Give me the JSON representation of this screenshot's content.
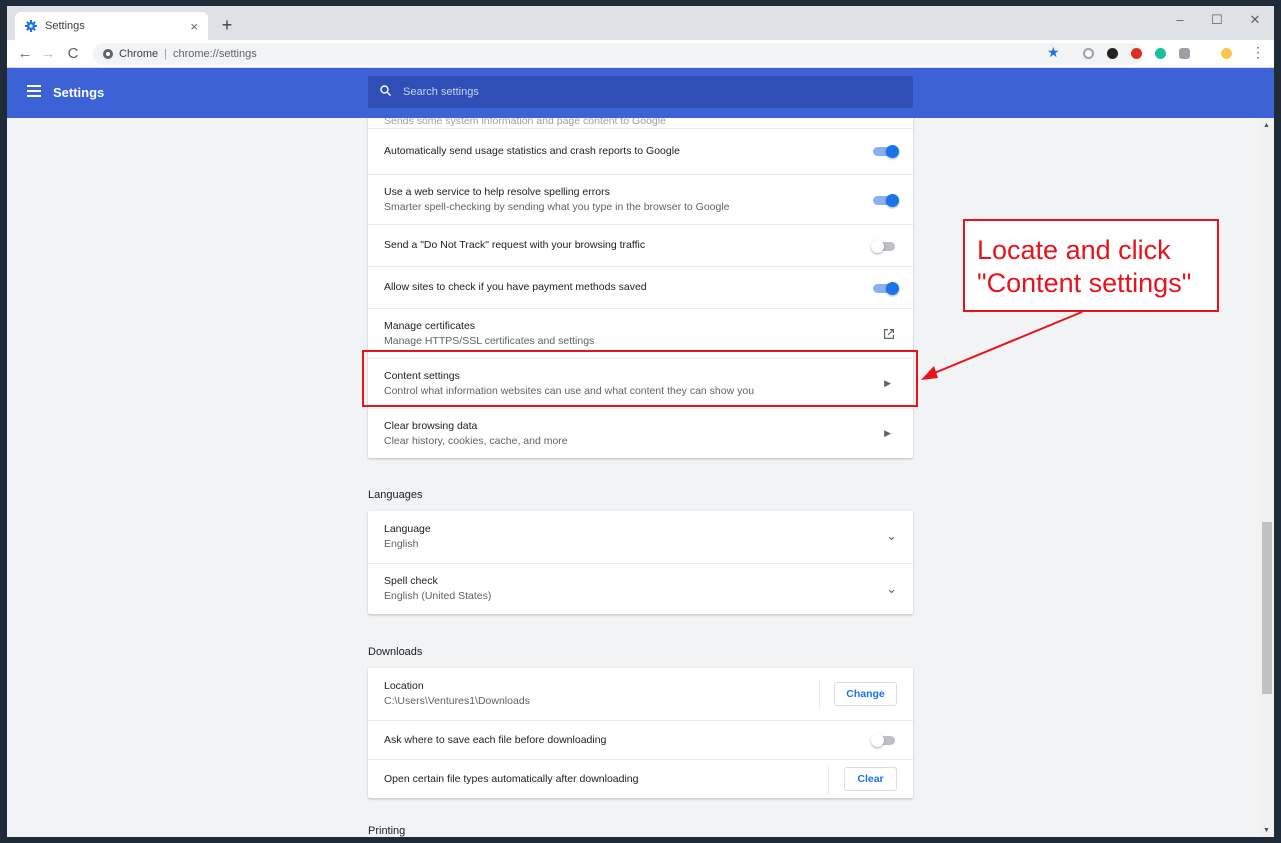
{
  "tab": {
    "title": "Settings",
    "close": "×",
    "new_tab": "+"
  },
  "window_controls": {
    "minimize": "–",
    "maximize": "☐",
    "close": "✕"
  },
  "omnibox": {
    "site": "Chrome",
    "separator": "|",
    "url": "chrome://settings"
  },
  "appbar": {
    "title": "Settings",
    "search_placeholder": "Search settings"
  },
  "privacy_rows": [
    {
      "primary": "Sends some system information and page content to Google",
      "secondary": ""
    },
    {
      "primary": "Automatically send usage statistics and crash reports to Google",
      "toggle": true
    },
    {
      "primary": "Use a web service to help resolve spelling errors",
      "secondary": "Smarter spell-checking by sending what you type in the browser to Google",
      "toggle": true
    },
    {
      "primary": "Send a \"Do Not Track\" request with your browsing traffic",
      "toggle": false
    },
    {
      "primary": "Allow sites to check if you have payment methods saved",
      "toggle": true
    },
    {
      "primary": "Manage certificates",
      "secondary": "Manage HTTPS/SSL certificates and settings"
    },
    {
      "primary": "Content settings",
      "secondary": "Control what information websites can use and what content they can show you"
    },
    {
      "primary": "Clear browsing data",
      "secondary": "Clear history, cookies, cache, and more"
    }
  ],
  "languages": {
    "heading": "Languages",
    "rows": [
      {
        "primary": "Language",
        "secondary": "English"
      },
      {
        "primary": "Spell check",
        "secondary": "English (United States)"
      }
    ]
  },
  "downloads": {
    "heading": "Downloads",
    "location_label": "Location",
    "location_value": "C:\\Users\\Ventures1\\Downloads",
    "change_button": "Change",
    "ask_label": "Ask where to save each file before downloading",
    "ask_toggle": false,
    "open_label": "Open certain file types automatically after downloading",
    "clear_button": "Clear"
  },
  "printing": {
    "heading": "Printing"
  },
  "annotation": {
    "line1": "Locate and click",
    "line2": "\"Content settings\""
  },
  "colors": {
    "accent": "#3c62d6",
    "toggle_on": "#1a73e8",
    "annotation_red": "#e8131b"
  }
}
